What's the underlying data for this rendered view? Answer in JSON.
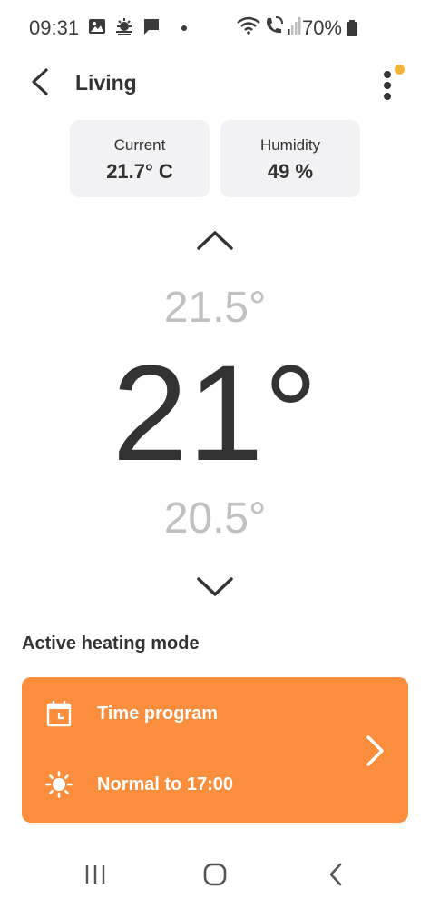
{
  "status_bar": {
    "time": "09:31",
    "battery": "70%",
    "icons_left": [
      "image-icon",
      "weather-icon",
      "message-icon",
      "dot-icon"
    ],
    "icons_right": [
      "wifi-icon",
      "wifi-call-icon",
      "signal-icon",
      "battery-icon"
    ]
  },
  "header": {
    "title": "Living",
    "back_icon": "chevron-left-icon",
    "menu_icon": "more-vert-icon",
    "menu_badge_color": "#f5b335"
  },
  "info_cards": {
    "current": {
      "label": "Current",
      "value": "21.7° C"
    },
    "humidity": {
      "label": "Humidity",
      "value": "49 %"
    }
  },
  "temperature": {
    "above": "21.5°",
    "current": "21°",
    "below": "20.5°"
  },
  "heating": {
    "section_title": "Active heating mode",
    "program_label": "Time program",
    "mode_label": "Normal to 17:00",
    "accent_color": "#fa8e3c"
  }
}
